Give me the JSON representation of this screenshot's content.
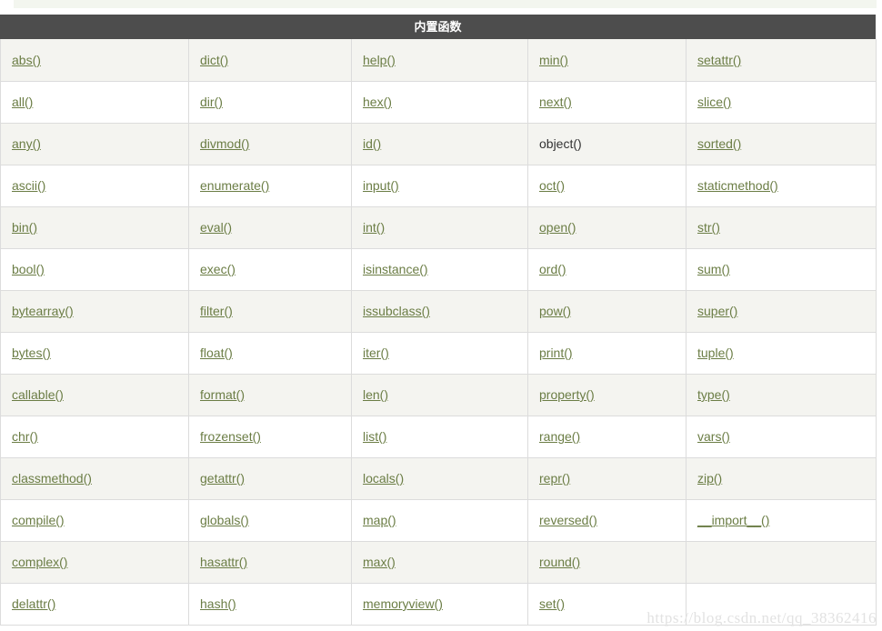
{
  "page": {
    "caption": "内置函数",
    "watermark": "https://blog.csdn.net/qq_38362416"
  },
  "colors": {
    "caption_bg": "#4d4d4d",
    "caption_text": "#ffffff",
    "link": "#6b7d45",
    "plain_text": "#333333",
    "row_odd_bg": "#f4f4f0",
    "row_even_bg": "#ffffff",
    "border": "#dcdcdc",
    "top_strip": "#f3f6ef",
    "watermark": "#e2e2e2"
  },
  "table": {
    "columns": 5,
    "rows": [
      [
        {
          "label": "abs()",
          "link": true
        },
        {
          "label": "dict()",
          "link": true
        },
        {
          "label": "help()",
          "link": true
        },
        {
          "label": "min()",
          "link": true
        },
        {
          "label": "setattr()",
          "link": true
        }
      ],
      [
        {
          "label": "all()",
          "link": true
        },
        {
          "label": "dir()",
          "link": true
        },
        {
          "label": "hex()",
          "link": true
        },
        {
          "label": "next()",
          "link": true
        },
        {
          "label": "slice()",
          "link": true
        }
      ],
      [
        {
          "label": "any()",
          "link": true
        },
        {
          "label": "divmod()",
          "link": true
        },
        {
          "label": "id()",
          "link": true
        },
        {
          "label": "object()",
          "link": false
        },
        {
          "label": "sorted()",
          "link": true
        }
      ],
      [
        {
          "label": "ascii()",
          "link": true
        },
        {
          "label": "enumerate()",
          "link": true
        },
        {
          "label": "input()",
          "link": true
        },
        {
          "label": "oct()",
          "link": true
        },
        {
          "label": "staticmethod()",
          "link": true
        }
      ],
      [
        {
          "label": "bin()",
          "link": true
        },
        {
          "label": "eval()",
          "link": true
        },
        {
          "label": "int()",
          "link": true
        },
        {
          "label": "open()",
          "link": true
        },
        {
          "label": "str()",
          "link": true
        }
      ],
      [
        {
          "label": "bool()",
          "link": true
        },
        {
          "label": "exec()",
          "link": true
        },
        {
          "label": "isinstance()",
          "link": true
        },
        {
          "label": "ord()",
          "link": true
        },
        {
          "label": "sum()",
          "link": true
        }
      ],
      [
        {
          "label": "bytearray()",
          "link": true
        },
        {
          "label": "filter()",
          "link": true
        },
        {
          "label": "issubclass()",
          "link": true
        },
        {
          "label": "pow()",
          "link": true
        },
        {
          "label": "super()",
          "link": true
        }
      ],
      [
        {
          "label": "bytes()",
          "link": true
        },
        {
          "label": "float()",
          "link": true
        },
        {
          "label": "iter()",
          "link": true
        },
        {
          "label": "print()",
          "link": true
        },
        {
          "label": "tuple()",
          "link": true
        }
      ],
      [
        {
          "label": "callable()",
          "link": true
        },
        {
          "label": "format()",
          "link": true
        },
        {
          "label": "len()",
          "link": true
        },
        {
          "label": "property()",
          "link": true
        },
        {
          "label": "type()",
          "link": true
        }
      ],
      [
        {
          "label": "chr()",
          "link": true
        },
        {
          "label": "frozenset()",
          "link": true
        },
        {
          "label": "list()",
          "link": true
        },
        {
          "label": "range()",
          "link": true
        },
        {
          "label": "vars()",
          "link": true
        }
      ],
      [
        {
          "label": "classmethod()",
          "link": true
        },
        {
          "label": "getattr()",
          "link": true
        },
        {
          "label": "locals()",
          "link": true
        },
        {
          "label": "repr()",
          "link": true
        },
        {
          "label": "zip()",
          "link": true
        }
      ],
      [
        {
          "label": "compile()",
          "link": true
        },
        {
          "label": "globals()",
          "link": true
        },
        {
          "label": "map()",
          "link": true
        },
        {
          "label": "reversed()",
          "link": true
        },
        {
          "label": "__import__()",
          "link": true
        }
      ],
      [
        {
          "label": "complex()",
          "link": true
        },
        {
          "label": "hasattr()",
          "link": true
        },
        {
          "label": "max()",
          "link": true
        },
        {
          "label": "round()",
          "link": true
        },
        {
          "label": "",
          "link": false
        }
      ],
      [
        {
          "label": "delattr()",
          "link": true
        },
        {
          "label": "hash()",
          "link": true
        },
        {
          "label": "memoryview()",
          "link": true
        },
        {
          "label": "set()",
          "link": true
        },
        {
          "label": "",
          "link": false
        }
      ]
    ]
  }
}
